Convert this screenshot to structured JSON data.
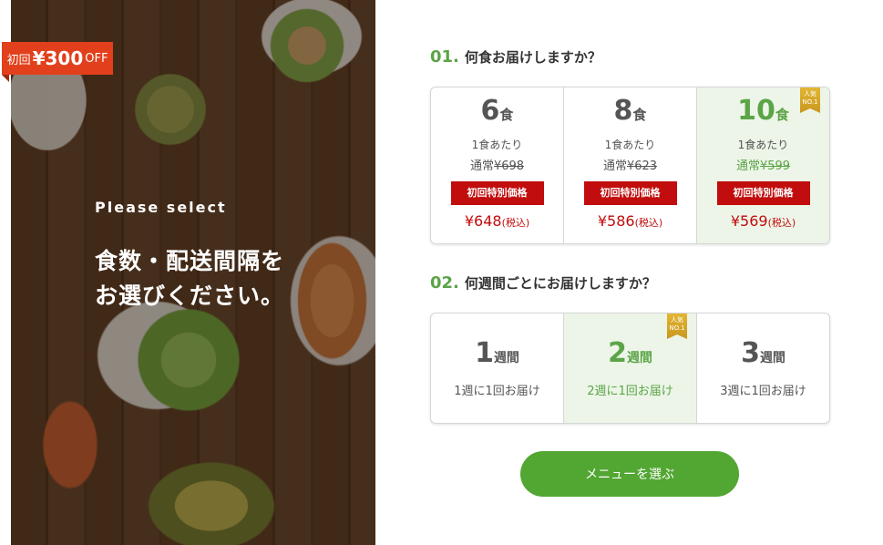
{
  "hero": {
    "badge": {
      "prefix": "初回",
      "amount": "¥300",
      "suffix": "OFF"
    },
    "subtitle": "Please select",
    "title_line1": "食数・配送間隔を",
    "title_line2": "お選びください。"
  },
  "q1": {
    "number": "01.",
    "text": "何食お届けしますか？",
    "options": [
      {
        "count": "6",
        "unit": "食",
        "per_meal": "1食あたり",
        "normal_label": "通常",
        "normal_price": "¥698",
        "special_label": "初回特別価格",
        "price": "¥648",
        "tax": "(税込)"
      },
      {
        "count": "8",
        "unit": "食",
        "per_meal": "1食あたり",
        "normal_label": "通常",
        "normal_price": "¥623",
        "special_label": "初回特別価格",
        "price": "¥586",
        "tax": "(税込)"
      },
      {
        "count": "10",
        "unit": "食",
        "per_meal": "1食あたり",
        "normal_label": "通常",
        "normal_price": "¥599",
        "special_label": "初回特別価格",
        "price": "¥569",
        "tax": "(税込)",
        "ribbon_line1": "人気",
        "ribbon_line2": "NO.1"
      }
    ]
  },
  "q2": {
    "number": "02.",
    "text": "何週間ごとにお届けしますか？",
    "options": [
      {
        "count": "1",
        "unit": "週間",
        "desc": "1週に1回お届け"
      },
      {
        "count": "2",
        "unit": "週間",
        "desc": "2週に1回お届け",
        "ribbon_line1": "人気",
        "ribbon_line2": "NO.1"
      },
      {
        "count": "3",
        "unit": "週間",
        "desc": "3週に1回お届け"
      }
    ]
  },
  "cta": {
    "label": "メニューを選ぶ"
  },
  "colors": {
    "accent_green": "#5ba447",
    "button_green": "#52a632",
    "price_red": "#c10d0d",
    "badge_orange": "#e2401c",
    "selected_bg": "#ecf5e8"
  }
}
